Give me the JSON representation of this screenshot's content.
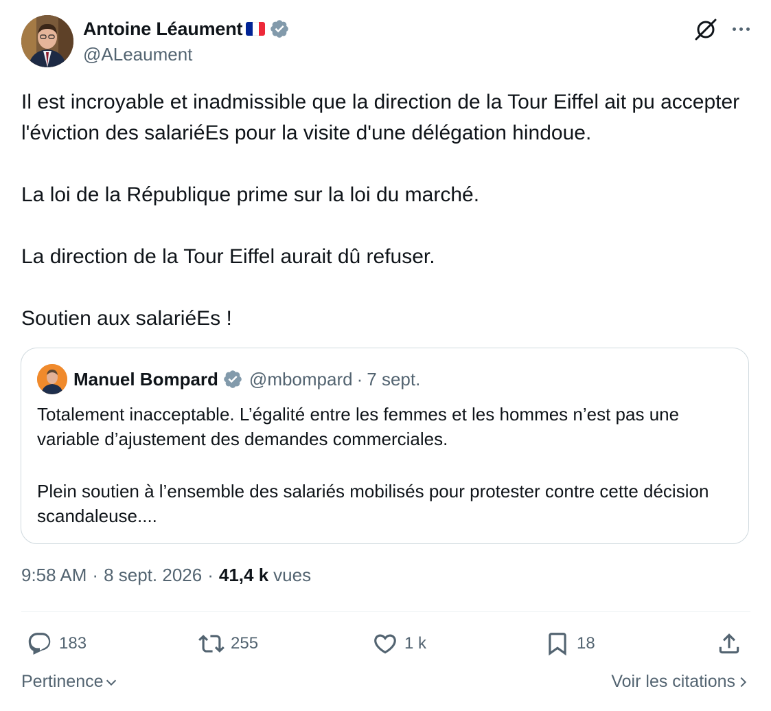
{
  "tweet": {
    "author": {
      "name": "Antoine Léaument",
      "handle": "@ALeaument",
      "flag_colors": [
        "#002395",
        "#ffffff",
        "#ed2939"
      ]
    },
    "paragraphs": [
      "Il est incroyable et inadmissible que la direction de la Tour Eiffel ait pu accepter l'éviction des salariéEs pour la visite d'une délégation hindoue.",
      "La loi de la République prime sur la loi du marché.",
      "La direction de la Tour Eiffel aurait dû refuser.",
      "Soutien aux salariéEs !"
    ],
    "quote": {
      "name": "Manuel Bompard",
      "handle": "@mbompard",
      "dot": "·",
      "date": "7 sept.",
      "paragraphs": [
        "Totalement inacceptable. L’égalité entre les femmes et les hommes n’est pas une variable d’ajustement des demandes commerciales.",
        "Plein soutien à l’ensemble des salariés mobilisés pour protester contre cette décision scandaleuse...."
      ]
    },
    "meta": {
      "time": "9:58 AM",
      "sep": "·",
      "date": "8 sept. 2026",
      "views_count": "41,4 k",
      "views_label": "vues"
    },
    "actions": {
      "replies": "183",
      "reposts": "255",
      "likes": "1 k",
      "bookmarks": "18"
    },
    "footer": {
      "sort_label": "Pertinence",
      "quotes_label": "Voir les citations"
    }
  },
  "icons": {
    "verified": "verified-badge-icon",
    "grok": "grok-icon",
    "more": "more-icon",
    "reply": "reply-icon",
    "repost": "repost-icon",
    "like": "like-icon",
    "bookmark": "bookmark-icon",
    "share": "share-icon",
    "chevron_down": "chevron-down-icon",
    "chevron_right": "chevron-right-icon"
  },
  "colors": {
    "text": "#0f1419",
    "secondary": "#536471",
    "verified": "#829aab",
    "border": "#cfd9de"
  }
}
